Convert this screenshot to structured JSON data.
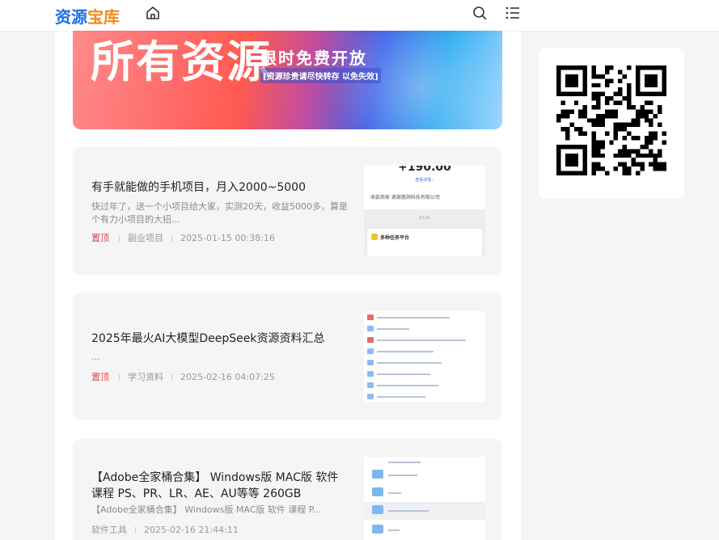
{
  "header": {
    "logo_part1": "资源",
    "logo_part2": "宝库"
  },
  "banner": {
    "title": "所有资源",
    "subtitle": "限时免费开放",
    "note": "[资源珍贵请尽快转存 以免失效]"
  },
  "posts": [
    {
      "title": "有手就能做的手机项目，月入2000~5000",
      "excerpt": "快过年了，送一个小项目给大家，实测20天，收益5000多，算是个有力小项目的大招...",
      "pin": "置顶",
      "category": "副业项目",
      "date": "2025-01-15 00:38:16",
      "thumb": {
        "amount": "+190.00",
        "sub": "查看详情 ›",
        "row": "收款商家    谢谢惠顾科技有限公司",
        "time": "12:21",
        "label": "多种任务平台"
      }
    },
    {
      "title": "2025年最火AI大模型DeepSeek资源资料汇总",
      "excerpt": "...",
      "pin": "置顶",
      "category": "学习资料",
      "date": "2025-02-16 04:07:25"
    },
    {
      "title": "【Adobe全家桶合集】 Windows版 MAC版 软件 课程 PS、PR、LR、AE、AU等等 260GB",
      "excerpt": "【Adobe全家桶合集】 Windows版 MAC版 软件 课程 P...",
      "category": "软件工具",
      "date": "2025-02-16 21:44:11"
    }
  ]
}
